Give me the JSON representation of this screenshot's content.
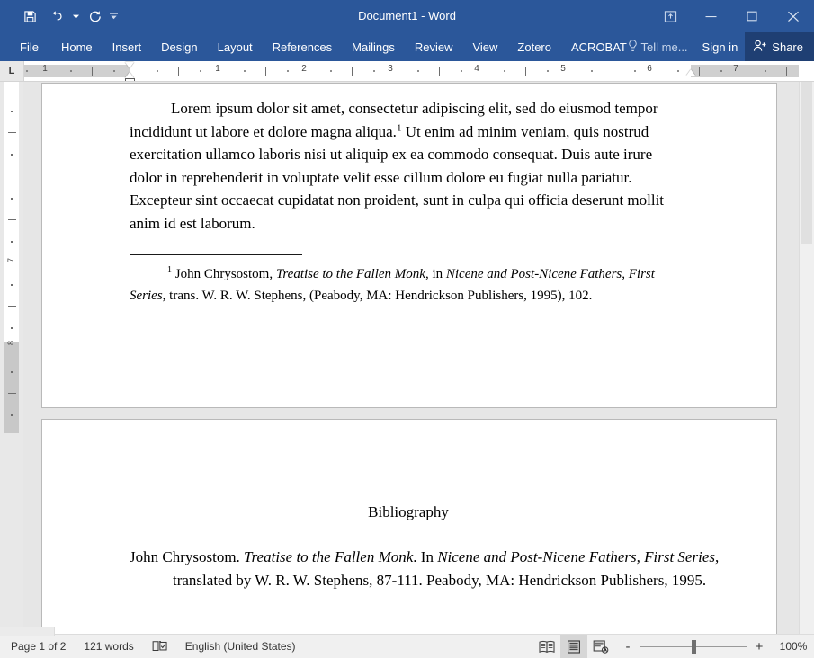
{
  "window": {
    "title": "Document1 - Word",
    "quick_access": [
      {
        "name": "save",
        "icon": "save-icon",
        "label": "Save"
      },
      {
        "name": "undo",
        "icon": "undo-icon",
        "label": "Undo"
      },
      {
        "name": "redo",
        "icon": "redo-icon",
        "label": "Redo"
      },
      {
        "name": "customize",
        "icon": "customize-quick-access-icon",
        "label": "Customize Quick Access Toolbar"
      }
    ],
    "controls": [
      {
        "name": "ribbon-display-options",
        "icon": "ribbon-display-options-icon",
        "label": "Ribbon Display Options"
      },
      {
        "name": "minimize",
        "icon": "minimize-icon",
        "label": "Minimize"
      },
      {
        "name": "maximize",
        "icon": "maximize-icon",
        "label": "Restore Down"
      },
      {
        "name": "close",
        "icon": "close-icon",
        "label": "Close"
      }
    ],
    "accent_color": "#2b579a",
    "share_bg_color": "#1f3f73"
  },
  "ribbon": {
    "tabs": [
      {
        "label": "File"
      },
      {
        "label": "Home"
      },
      {
        "label": "Insert"
      },
      {
        "label": "Design"
      },
      {
        "label": "Layout"
      },
      {
        "label": "References"
      },
      {
        "label": "Mailings"
      },
      {
        "label": "Review"
      },
      {
        "label": "View"
      },
      {
        "label": "Zotero"
      },
      {
        "label": "ACROBAT"
      }
    ],
    "tell_me": "Tell me...",
    "sign_in": "Sign in",
    "share": "Share"
  },
  "ruler": {
    "tab_stop_selector": "L",
    "horizontal_numbers": [
      "1",
      "1",
      "2",
      "3",
      "4",
      "5",
      "6",
      "7"
    ],
    "vertical_numbers": [
      "7",
      "8"
    ]
  },
  "document": {
    "page1": {
      "body_paragraph": {
        "text_before_note": "Lorem ipsum dolor sit amet, consectetur adipiscing elit, sed do eiusmod tempor incididunt ut labore et dolore magna aliqua.",
        "note_marker": "1",
        "text_after_note": " Ut enim ad minim veniam, quis nostrud exercitation ullamco laboris nisi ut aliquip ex ea commodo consequat. Duis aute irure dolor in reprehenderit in voluptate velit esse cillum dolore eu fugiat nulla pariatur. Excepteur sint occaecat cupidatat non proident, sunt in culpa qui officia deserunt mollit anim id est laborum."
      },
      "footnote": {
        "marker": "1",
        "part1": " John Chrysostom, ",
        "italic1": "Treatise to the Fallen Monk",
        "part2": ", in ",
        "italic2": "Nicene and Post-Nicene Fathers, First Series",
        "part3": ", trans. W. R. W. Stephens, (Peabody, MA: Hendrickson Publishers, 1995), 102."
      }
    },
    "page2": {
      "heading": "Bibliography",
      "entry": {
        "part1": "John Chrysostom. ",
        "italic1": "Treatise to the Fallen Monk",
        "part2": ". In ",
        "italic2": "Nicene and Post-Nicene Fathers, First Series",
        "part3": ", translated by W. R. W. Stephens, 87-111. Peabody, MA: Hendrickson Publishers, 1995."
      }
    }
  },
  "status_bar": {
    "page_count": "Page 1 of 2",
    "word_count": "121 words",
    "proofing_icon": "proofing-errors-icon",
    "language": "English (United States)",
    "views": [
      {
        "name": "read-mode",
        "label": "Read Mode",
        "active": false
      },
      {
        "name": "print-layout",
        "label": "Print Layout",
        "active": true
      },
      {
        "name": "web-layout",
        "label": "Web Layout",
        "active": false
      }
    ],
    "zoom_out": "-",
    "zoom_in": "+",
    "zoom_level": "100%"
  }
}
